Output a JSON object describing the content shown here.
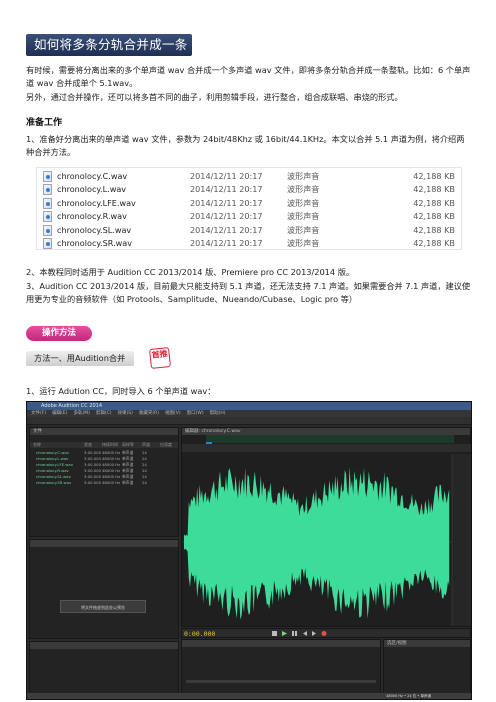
{
  "title": "如何将多条分轨合并成一条整轨",
  "intro_1": "有时候，需要将分离出来的多个单声道 wav 合并成一个多声道 wav 文件，即将多条分轨合并成一条整轨。比如：6 个单声道 wav 合并成单个 5.1wav。",
  "intro_2": "另外，通过合并操作，还可以将多首不同的曲子，利用剪辑手段，进行整合，组合成联唱、串烧的形式。",
  "prep_heading": "准备工作",
  "prep_1": "1、准备好分离出来的单声道 wav 文件，参数为 24bit/48Khz 或 16bit/44.1KHz。本文以合并 5.1 声道为例，将介绍两种合并方法。",
  "files": [
    {
      "name": "chronolocy.C.wav",
      "date": "2014/12/11 20:17",
      "type": "波形声音",
      "size": "42,188 KB"
    },
    {
      "name": "chronolocy.L.wav",
      "date": "2014/12/11 20:17",
      "type": "波形声音",
      "size": "42,188 KB"
    },
    {
      "name": "chronolocy.LFE.wav",
      "date": "2014/12/11 20:17",
      "type": "波形声音",
      "size": "42,188 KB"
    },
    {
      "name": "chronolocy.R.wav",
      "date": "2014/12/11 20:17",
      "type": "波形声音",
      "size": "42,188 KB"
    },
    {
      "name": "chronolocy.SL.wav",
      "date": "2014/12/11 20:17",
      "type": "波形声音",
      "size": "42,188 KB"
    },
    {
      "name": "chronolocy.SR.wav",
      "date": "2014/12/11 20:17",
      "type": "波形声音",
      "size": "42,188 KB"
    }
  ],
  "prep_2": "2、本教程同时适用于 Audition CC 2013/2014 版、Premiere pro CC 2013/2014 版。",
  "prep_3": "3、Audition CC 2013/2014 版，目前最大只能支持到 5.1 声道，还无法支持 7.1 声道。如果需要合并 7.1 声道，建议使用更为专业的音频软件（如 Protools、Samplitude、Nueando/Cubase、Logic pro 等）",
  "op_badge": "操作方法",
  "method_1": "方法一、用Audition合并",
  "first_tag": "首推",
  "step_1": "1、运行 Adution CC，同时导入 6 个单声道 wav：",
  "screenshot": {
    "window_title": "Adobe Audition CC 2014",
    "menu": [
      "文件(F)",
      "编辑(E)",
      "多轨(M)",
      "剪辑(C)",
      "效果(S)",
      "收藏夹(R)",
      "视图(V)",
      "窗口(W)",
      "帮助(H)"
    ],
    "files_panel": "文件",
    "file_columns": [
      "名称",
      "状态",
      "持续时间",
      "采样率",
      "声道",
      "位深度"
    ],
    "file_rows": [
      {
        "name": "chronolocy.C.wav",
        "dur": "3:00.000",
        "rate": "48000 Hz",
        "ch": "单声道",
        "bit": "24"
      },
      {
        "name": "chronolocy.L.wav",
        "dur": "3:00.000",
        "rate": "48000 Hz",
        "ch": "单声道",
        "bit": "24"
      },
      {
        "name": "chronolocy.LFE.wav",
        "dur": "3:00.000",
        "rate": "48000 Hz",
        "ch": "单声道",
        "bit": "24"
      },
      {
        "name": "chronolocy.R.wav",
        "dur": "3:00.000",
        "rate": "48000 Hz",
        "ch": "单声道",
        "bit": "24"
      },
      {
        "name": "chronolocy.SL.wav",
        "dur": "3:00.000",
        "rate": "48000 Hz",
        "ch": "单声道",
        "bit": "24"
      },
      {
        "name": "chronolocy.SR.wav",
        "dur": "3:00.000",
        "rate": "48000 Hz",
        "ch": "单声道",
        "bit": "24"
      }
    ],
    "media_placeholder": "将文件拖放到此处以预览",
    "editor_tab": "编辑器: chronolocy.C.wav",
    "timecode": "0:00.000",
    "sel_header": "选区/视图",
    "status": "48000 Hz • 24 位 • 单声道"
  },
  "colors": {
    "banner": "#2b3d64",
    "waveform": "#3ddc9a",
    "accent_pink": "#d8348c"
  }
}
